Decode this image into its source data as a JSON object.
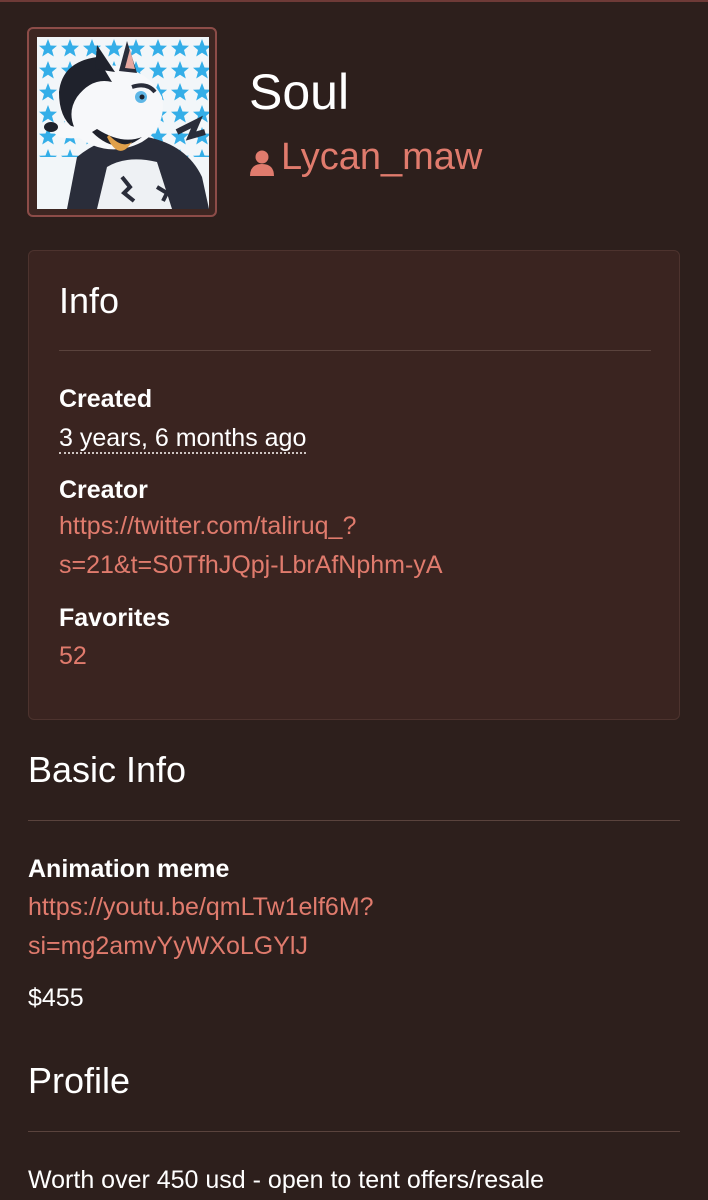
{
  "character": {
    "name": "Soul",
    "owner": "Lycan_maw"
  },
  "info": {
    "title": "Info",
    "created_label": "Created",
    "created_value": "3 years, 6 months ago",
    "creator_label": "Creator",
    "creator_line1": "https://twitter.com/taliruq_?",
    "creator_line2": "s=21&t=S0TfhJQpj-LbrAfNphm-yA",
    "favorites_label": "Favorites",
    "favorites_value": "52"
  },
  "basic_info": {
    "title": "Basic Info",
    "field_label": "Animation meme",
    "link_line1": "https://youtu.be/qmLTw1elf6M?",
    "link_line2": "si=mg2amvYyWXoLGYlJ",
    "price": "$455"
  },
  "profile": {
    "title": "Profile",
    "text": "Worth over 450 usd - open to tent offers/resale"
  },
  "colors": {
    "background": "#2d1f1c",
    "card": "#3a2420",
    "accent": "#e07b6d"
  },
  "icons": {
    "owner": "user-icon"
  }
}
